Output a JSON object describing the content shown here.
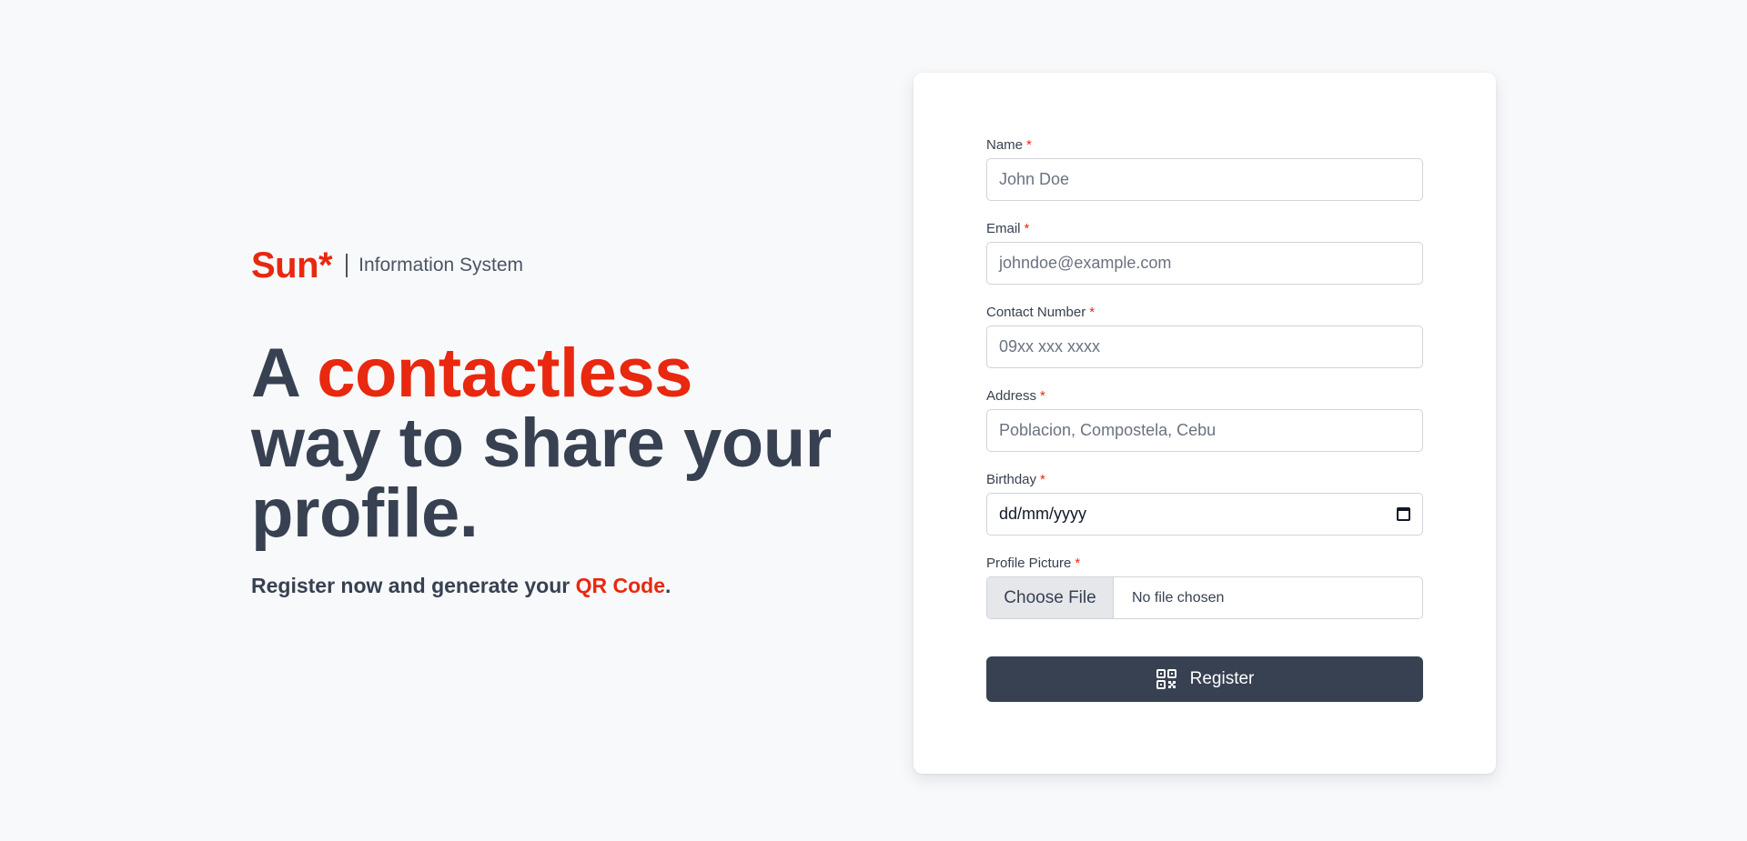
{
  "brand": {
    "logo": "Sun*",
    "subtitle": "Information System"
  },
  "hero": {
    "headline_prefix": "A ",
    "headline_accent": "contactless",
    "headline_rest": "way to share your profile.",
    "tagline_prefix": "Register now and generate your ",
    "tagline_accent": "QR Code",
    "tagline_suffix": "."
  },
  "form": {
    "required_mark": "*",
    "name": {
      "label": "Name",
      "placeholder": "John Doe"
    },
    "email": {
      "label": "Email",
      "placeholder": "johndoe@example.com"
    },
    "contact": {
      "label": "Contact Number",
      "placeholder": "09xx xxx xxxx"
    },
    "address": {
      "label": "Address",
      "placeholder": "Poblacion, Compostela, Cebu"
    },
    "birthday": {
      "label": "Birthday",
      "value": "dd/mm/yyyy"
    },
    "picture": {
      "label": "Profile Picture",
      "button": "Choose File",
      "status": "No file chosen"
    },
    "submit_label": "Register"
  },
  "icons": {
    "calendar": "calendar-icon",
    "register": "qr-code-icon"
  },
  "colors": {
    "accent": "#e8280f",
    "text": "#374151",
    "button_bg": "#384152",
    "background": "#f8f9fb"
  }
}
